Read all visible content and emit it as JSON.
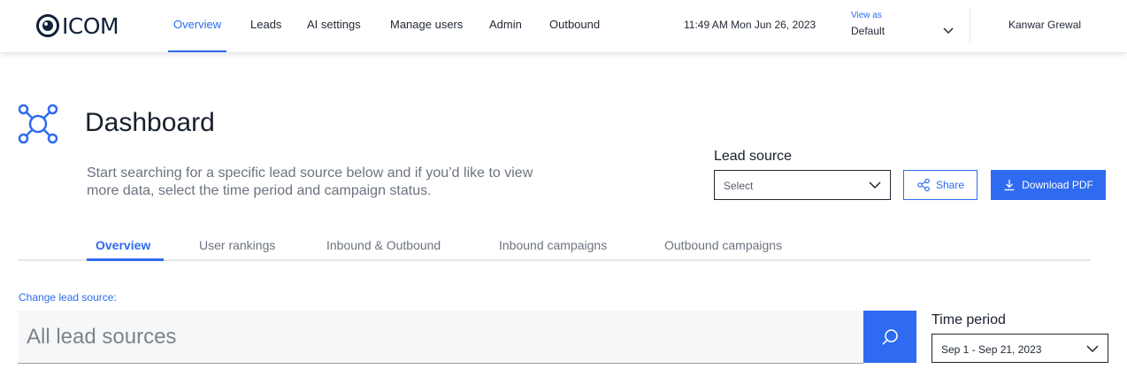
{
  "brand": {
    "name": "ICOM",
    "accent_color": "#2e6bf0"
  },
  "nav": {
    "items": [
      {
        "label": "Overview",
        "active": true
      },
      {
        "label": "Leads",
        "active": false
      },
      {
        "label": "AI settings",
        "active": false
      },
      {
        "label": "Manage users",
        "active": false
      },
      {
        "label": "Admin",
        "active": false
      },
      {
        "label": "Outbound",
        "active": false
      }
    ],
    "datetime": "11:49 AM Mon Jun 26, 2023",
    "view_as": {
      "label": "View as",
      "value": "Default",
      "icon": "chevron-down-icon"
    },
    "user_name": "Kanwar Grewal"
  },
  "header": {
    "icon": "network-nodes-icon",
    "title": "Dashboard",
    "description": "Start searching for a specific lead source below and if you’d like to view more data, select the time period and campaign status."
  },
  "lead_source": {
    "label": "Lead source",
    "selected": "Select",
    "icon": "chevron-down-icon"
  },
  "actions": {
    "share_label": "Share",
    "share_icon": "share-icon",
    "download_label": "Download PDF",
    "download_icon": "download-icon"
  },
  "tabs": [
    {
      "label": "Overview",
      "active": true
    },
    {
      "label": "User rankings",
      "active": false
    },
    {
      "label": "Inbound & Outbound",
      "active": false
    },
    {
      "label": "Inbound campaigns",
      "active": false
    },
    {
      "label": "Outbound campaigns",
      "active": false
    }
  ],
  "search": {
    "change_label": "Change lead source:",
    "placeholder": "All lead sources",
    "value": "",
    "button_icon": "search-icon"
  },
  "time_period": {
    "label": "Time period",
    "selected": "Sep 1 - Sep 21, 2023",
    "icon": "chevron-down-icon"
  }
}
